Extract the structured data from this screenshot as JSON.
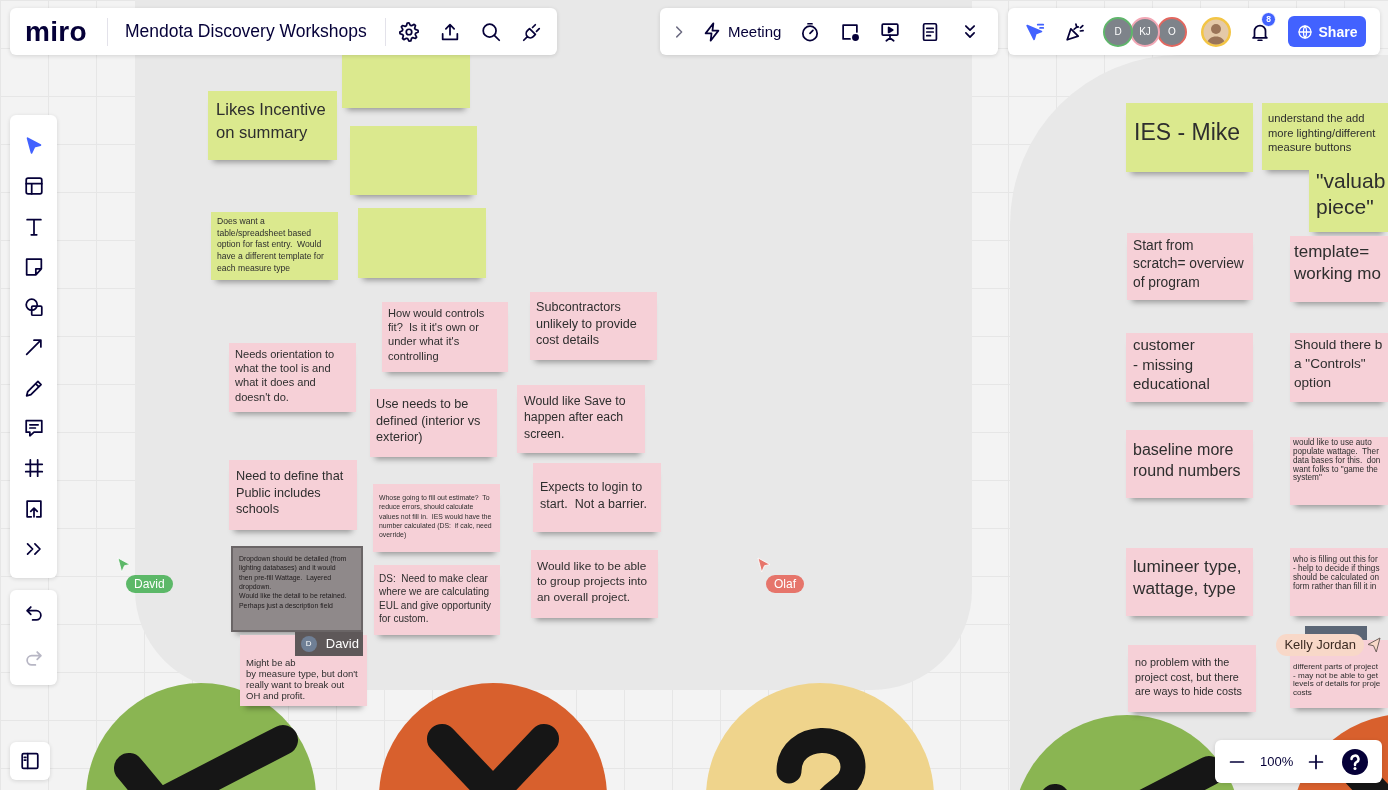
{
  "top_bar": {
    "logo": "miro",
    "board_title": "Mendota Discovery Workshops"
  },
  "meeting_bar": {
    "label": "Meeting"
  },
  "collaborators": [
    {
      "kind": "initials",
      "initials": "D",
      "color": "#5fb56b"
    },
    {
      "kind": "initials",
      "initials": "KJ",
      "color": "#f2a7b5"
    },
    {
      "kind": "initials",
      "initials": "O",
      "color": "#e2675f"
    },
    {
      "kind": "photo",
      "color": "#f3c545"
    }
  ],
  "notifications": {
    "count": "8"
  },
  "share_button": {
    "label": "Share"
  },
  "tools": [
    {
      "kind": "select",
      "selected": true
    },
    {
      "kind": "templates",
      "selected": false
    },
    {
      "kind": "text",
      "selected": false
    },
    {
      "kind": "sticky",
      "selected": false
    },
    {
      "kind": "shapes",
      "selected": false
    },
    {
      "kind": "line",
      "selected": false
    },
    {
      "kind": "pen",
      "selected": false
    },
    {
      "kind": "comment",
      "selected": false
    },
    {
      "kind": "frame",
      "selected": false
    },
    {
      "kind": "upload",
      "selected": false
    },
    {
      "kind": "more",
      "selected": false
    }
  ],
  "history": [
    {
      "kind": "undo",
      "disabled": false
    },
    {
      "kind": "redo",
      "disabled": true
    }
  ],
  "sticky_notes": [
    {
      "color": "#dbe98e"
    },
    {
      "text": "Likes Incentive\non summary",
      "color": "#dbe98e"
    },
    {
      "color": "#dbe98e"
    },
    {
      "text": "Does want a\ntable/spreadsheet based\noption for fast entry.  Would\nhave a different template for\neach measure type",
      "color": "#dbe98e"
    },
    {
      "color": "#dbe98e"
    },
    {
      "text": "How would controls\nfit?  Is it it's own or\nunder what it's\ncontrolling",
      "color": "#f6d0d7"
    },
    {
      "text": "Subcontractors\nunlikely to provide\ncost details",
      "color": "#f6d0d7"
    },
    {
      "text": "Needs orientation to\nwhat the tool is and\nwhat it does and\ndoesn't do.",
      "color": "#f6d0d7"
    },
    {
      "text": "Use needs to be\ndefined (interior vs\nexterior)",
      "color": "#f6d0d7"
    },
    {
      "text": "Would like Save to\nhappen after each\nscreen.",
      "color": "#f6d0d7"
    },
    {
      "text": "Need to define that\nPublic includes\nschools",
      "color": "#f6d0d7"
    },
    {
      "text": "Whose going to fill out estimate?  To\nreduce errors, should calculate\nvalues not fill in.  IES would have the\nnumber calculated (DS:  if calc, need\noverride)",
      "color": "#f6d0d7"
    },
    {
      "text": "Expects to login to\nstart.  Not a barrier.",
      "color": "#f6d0d7"
    },
    {
      "text": "Dropdown should be detailed (from\nlighting databases) and it would\nthen pre-fill Wattage.  Layered\ndropdown.\nWould like the detail to be retained.\nPerhaps just a description field",
      "color": "#8f898a",
      "locked_by": {
        "initial": "D",
        "name": "David"
      }
    },
    {
      "text": "DS:  Need to make clear\nwhere we are calculating\nEUL and give opportunity\nfor custom.",
      "color": "#f6d0d7"
    },
    {
      "text": "Would like to be able\nto group projects into\nan overall project.",
      "color": "#f6d0d7"
    },
    {
      "text": "Might be ab\nby measure type, but don't\nreally want to break out\nOH and profit.",
      "color": "#f6d0d7"
    },
    {
      "text": "IES - Mike",
      "color": "#dbe98e"
    },
    {
      "text": "understand the add\nmore lighting/different\nmeasure buttons",
      "color": "#dbe98e"
    },
    {
      "text": "\"valuab\npiece\"",
      "color": "#dbe98e"
    },
    {
      "text": "Start from\nscratch= overview\nof program",
      "color": "#f6d0d7"
    },
    {
      "text": "template=\nworking mo",
      "color": "#f6d0d7"
    },
    {
      "text": "customer\n- missing\neducational",
      "color": "#f6d0d7"
    },
    {
      "text": "Should there b\na \"Controls\"\noption",
      "color": "#f6d0d7"
    },
    {
      "text": "baseline more\nround numbers",
      "color": "#f6d0d7"
    },
    {
      "text": "would like to use auto\npopulate wattage.  Ther\ndata bases for this.  don\nwant folks to \"game the\nsystem\"",
      "color": "#f6d0d7"
    },
    {
      "text": "lumineer type,\nwattage, type",
      "color": "#f6d0d7"
    },
    {
      "text": "who is filling out this for\n- help to decide if things\nshould be calculated on\nform rather than fill it in",
      "color": "#f6d0d7"
    },
    {
      "text": "no problem with the\nproject cost, but there\nare ways to hide costs",
      "color": "#f6d0d7"
    },
    {
      "text": "different parts of project\n- may not be able to get\nlevels of details for proje\ncosts",
      "color": "#f6d0d7"
    }
  ],
  "cursors": [
    {
      "name": "David",
      "color": "#5cb868"
    },
    {
      "name": "Olaf",
      "color": "#e6756b"
    },
    {
      "name": "Kelly Jordan",
      "color": "#f8d8c8"
    }
  ],
  "stickers": [
    {
      "kind": "check",
      "color": "#8ab552"
    },
    {
      "kind": "cross",
      "color": "#d8602d"
    },
    {
      "kind": "question",
      "color": "#efd48c"
    },
    {
      "kind": "check",
      "color": "#8ab552"
    },
    {
      "kind": "cross",
      "color": "#d8602d"
    }
  ],
  "zoom": {
    "value": "100%"
  }
}
